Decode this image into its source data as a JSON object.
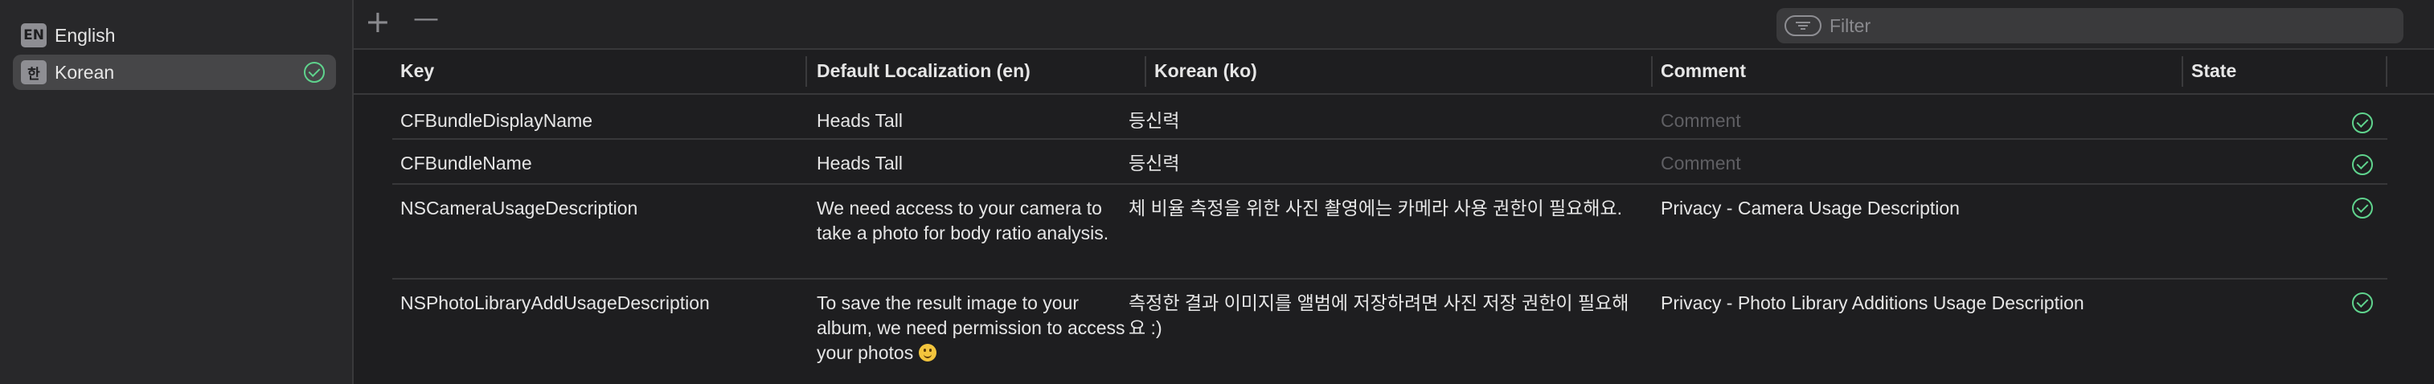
{
  "sidebar": {
    "languages": [
      {
        "badge": "EN",
        "label": "English",
        "selected": false
      },
      {
        "badge": "한",
        "label": "Korean",
        "selected": true,
        "status": "complete"
      }
    ]
  },
  "toolbar": {
    "add_label": "+",
    "remove_label": "—",
    "filter_placeholder": "Filter"
  },
  "table": {
    "columns": [
      "Key",
      "Default Localization (en)",
      "Korean (ko)",
      "Comment",
      "State"
    ],
    "rows": [
      {
        "key": "CFBundleDisplayName",
        "default": "Heads Tall",
        "korean": "등신력",
        "comment": "Comment",
        "comment_is_placeholder": true,
        "state": "complete"
      },
      {
        "key": "CFBundleName",
        "default": "Heads Tall",
        "korean": "등신력",
        "comment": "Comment",
        "comment_is_placeholder": true,
        "state": "complete"
      },
      {
        "key": "NSCameraUsageDescription",
        "default": "We need access to your camera to take a photo for body ratio analysis.",
        "korean": "체 비율 측정을 위한 사진 촬영에는 카메라 사용 권한이 필요해요.",
        "comment": "Privacy - Camera Usage Description",
        "comment_is_placeholder": false,
        "state": "complete"
      },
      {
        "key": "NSPhotoLibraryAddUsageDescription",
        "default": "To save the result image to your album, we need permission to access your photos",
        "default_emoji": "smiling-face",
        "korean": "측정한 결과 이미지를 앨범에 저장하려면 사진 저장 권한이 필요해요 :)",
        "comment": "Privacy - Photo Library Additions Usage Description",
        "comment_is_placeholder": false,
        "state": "complete"
      }
    ]
  },
  "colors": {
    "accent_check": "#5fd38d",
    "background": "#1e1e20",
    "sidebar": "#28282a"
  }
}
